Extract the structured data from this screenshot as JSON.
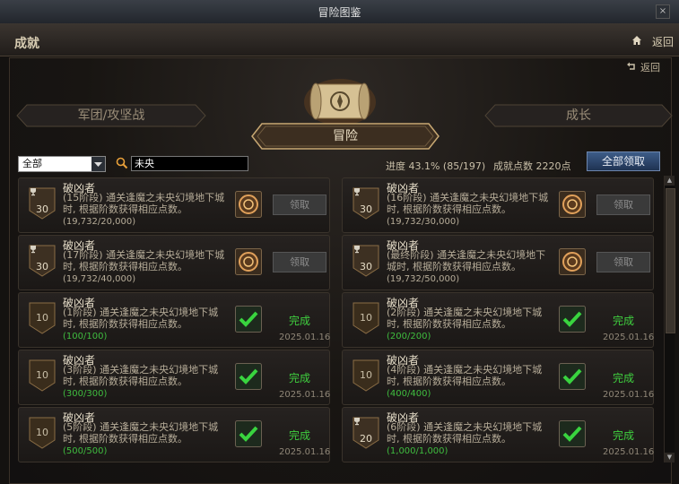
{
  "window": {
    "title": "冒险图鉴",
    "close": "×"
  },
  "header": {
    "title": "成就",
    "back": "返回"
  },
  "sub_back": "返回",
  "tabs": {
    "guild": "军团/攻坚战",
    "adventure": "冒险",
    "growth": "成长"
  },
  "filter": {
    "selected": "全部"
  },
  "search": {
    "value": "未央"
  },
  "progress": {
    "text": "进度  43.1% (85/197)"
  },
  "points": {
    "text": "成就点数  2220点"
  },
  "claim_all": "全部领取",
  "cards": [
    {
      "points": "30",
      "name": "破凶者",
      "desc": "(15阶段) 通关逢魔之未央幻境地下城时, 根据阶数获得相应点数。",
      "progress": "(19,732/20,000)",
      "claim": "领取"
    },
    {
      "points": "30",
      "name": "破凶者",
      "desc": "(16阶段) 通关逢魔之未央幻境地下城时, 根据阶数获得相应点数。",
      "progress": "(19,732/30,000)",
      "claim": "领取"
    },
    {
      "points": "30",
      "name": "破凶者",
      "desc": "(17阶段) 通关逢魔之未央幻境地下城时, 根据阶数获得相应点数。",
      "progress": "(19,732/40,000)",
      "claim": "领取"
    },
    {
      "points": "30",
      "name": "破凶者",
      "desc": "(最终阶段) 通关逢魔之未央幻境地下城时, 根据阶数获得相应点数。",
      "progress": "(19,732/50,000)",
      "claim": "领取"
    },
    {
      "points": "10",
      "name": "破凶者",
      "desc": "(1阶段) 通关逢魔之未央幻境地下城时, 根据阶数获得相应点数。",
      "progress": "(100/100)",
      "status": "完成",
      "date": "2025.01.16"
    },
    {
      "points": "10",
      "name": "破凶者",
      "desc": "(2阶段) 通关逢魔之未央幻境地下城时, 根据阶数获得相应点数。",
      "progress": "(200/200)",
      "status": "完成",
      "date": "2025.01.16"
    },
    {
      "points": "10",
      "name": "破凶者",
      "desc": "(3阶段) 通关逢魔之未央幻境地下城时, 根据阶数获得相应点数。",
      "progress": "(300/300)",
      "status": "完成",
      "date": "2025.01.16"
    },
    {
      "points": "10",
      "name": "破凶者",
      "desc": "(4阶段) 通关逢魔之未央幻境地下城时, 根据阶数获得相应点数。",
      "progress": "(400/400)",
      "status": "完成",
      "date": "2025.01.16"
    },
    {
      "points": "10",
      "name": "破凶者",
      "desc": "(5阶段) 通关逢魔之未央幻境地下城时, 根据阶数获得相应点数。",
      "progress": "(500/500)",
      "status": "完成",
      "date": "2025.01.16"
    },
    {
      "points": "20",
      "name": "破凶者",
      "desc": "(6阶段) 通关逢魔之未央幻境地下城时, 根据阶数获得相应点数。",
      "progress": "(1,000/1,000)",
      "status": "完成",
      "date": "2025.01.16"
    }
  ]
}
